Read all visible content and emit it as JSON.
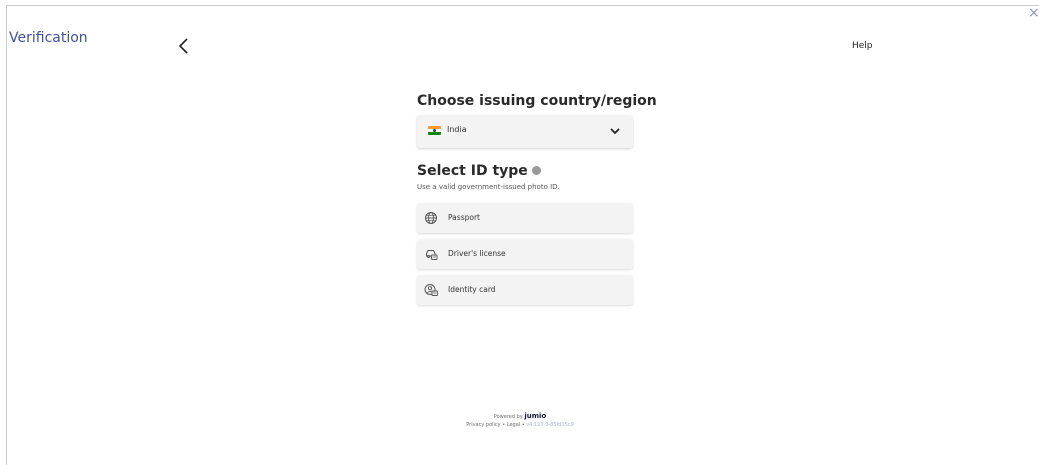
{
  "header": {
    "title": "Verification",
    "help_label": "Help",
    "close_glyph": "×",
    "back_icon": "chevron-left-icon"
  },
  "country": {
    "heading": "Choose issuing country/region",
    "selected": "India",
    "flag_icon": "india-flag-icon",
    "dropdown_icon": "chevron-down-icon"
  },
  "id_type": {
    "heading": "Select ID type",
    "subtitle": "Use a valid government-issued photo ID.",
    "options": [
      {
        "label": "Passport",
        "icon": "globe-icon"
      },
      {
        "label": "Driver's license",
        "icon": "car-card-icon"
      },
      {
        "label": "Identity card",
        "icon": "person-card-icon"
      }
    ]
  },
  "footer": {
    "powered_by": "Powered by",
    "brand": "jumio",
    "privacy": "Privacy policy",
    "separator": "•",
    "legal": "Legal",
    "version": "v4.123.0-85fd15c9"
  },
  "colors": {
    "title": "#3f4fa8",
    "card_bg": "#f3f3f3",
    "version": "#a8b0cf"
  }
}
